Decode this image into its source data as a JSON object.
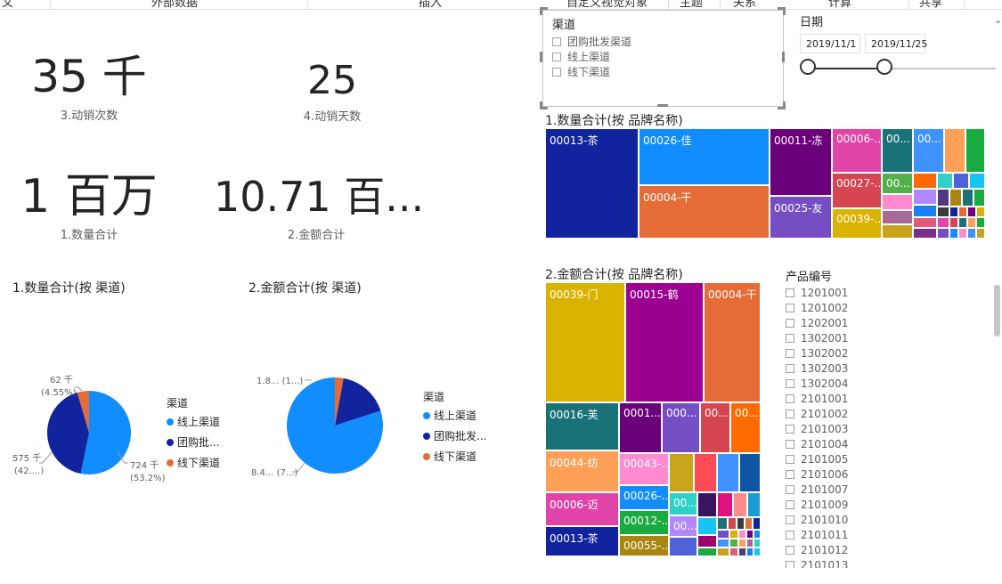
{
  "ribbon": {
    "tabs": [
      "文",
      "外部数据",
      "插入",
      "自定义视觉对象",
      "主题",
      "关系",
      "计算",
      "共享"
    ]
  },
  "kpis": [
    {
      "value": "35 千",
      "label": "3.动销次数"
    },
    {
      "value": "25",
      "label": "4.动销天数"
    },
    {
      "value": "1 百万",
      "label": "1.数量合计"
    },
    {
      "value": "10.71 百...",
      "label": "2.金额合计"
    }
  ],
  "pie_qty": {
    "title": "1.数量合计(按 渠道)",
    "legend_title": "渠道",
    "labels": {
      "online": "724 千",
      "online_pct": "(53.2%)",
      "group": "575 千",
      "group_pct": "(42....)",
      "offline": "62 千",
      "offline_pct": "(4.55%)"
    },
    "legend": [
      "线上渠道",
      "团购批...",
      "线下渠道"
    ]
  },
  "pie_amt": {
    "title": "2.金额合计(按 渠道)",
    "legend_title": "渠道",
    "labels": {
      "small": "1.8... (1...)",
      "large": "8.4... (7...)"
    },
    "legend": [
      "线上渠道",
      "团购批发...",
      "线下渠道"
    ]
  },
  "channel_slicer": {
    "title": "渠道",
    "items": [
      "团购批发渠道",
      "线上渠道",
      "线下渠道"
    ]
  },
  "date_slicer": {
    "title": "日期",
    "start": "2019/11/1",
    "end": "2019/11/25"
  },
  "treemap_qty": {
    "title": "1.数量合计(按 品牌名称)",
    "labels": [
      "00013-茶",
      "00026-佳",
      "00004-干",
      "00011-冻",
      "00025-友",
      "00006-...",
      "00027-...",
      "00039-...",
      "00...",
      "00...",
      "00..."
    ]
  },
  "treemap_amt": {
    "title": "2.金额合计(按 品牌名称)",
    "labels": [
      "00039-门",
      "00015-鹤",
      "00004-干",
      "00016-芙",
      "0001...",
      "000...",
      "00...",
      "00...",
      "00044-纺",
      "00043-...",
      "00006-迈",
      "00026-...",
      "00012-...",
      "00013-茶",
      "00055-...",
      "00...",
      "00..."
    ]
  },
  "product_slicer": {
    "title": "产品编号",
    "items": [
      "1201001",
      "1201002",
      "1202001",
      "1302001",
      "1302002",
      "1302003",
      "1302004",
      "2101001",
      "2101002",
      "2101003",
      "2101004",
      "2101005",
      "2101006",
      "2101007",
      "2101009",
      "2101010",
      "2101011",
      "2101012",
      "2101013"
    ]
  },
  "chart_data": [
    {
      "type": "pie",
      "title": "1.数量合计(按 渠道)",
      "categories": [
        "线上渠道",
        "团购批发渠道",
        "线下渠道"
      ],
      "values": [
        724,
        575,
        62
      ],
      "unit": "千",
      "percent_labels": [
        "53.2%",
        "42....",
        "4.55%"
      ]
    },
    {
      "type": "pie",
      "title": "2.金额合计(按 渠道)",
      "categories": [
        "线上渠道",
        "团购批发渠道",
        "线下渠道"
      ],
      "values": [
        8.4,
        1.8,
        0.3
      ]
    }
  ],
  "colors": {
    "online": "#118DFF",
    "group": "#12239E",
    "offline": "#E66C37"
  }
}
